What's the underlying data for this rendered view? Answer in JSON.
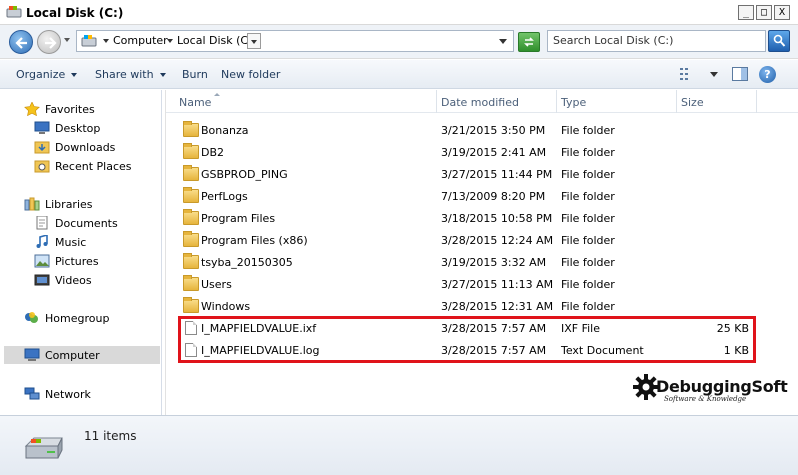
{
  "window": {
    "title": "Local Disk (C:)",
    "controls": [
      "_",
      "□",
      "X"
    ]
  },
  "address": {
    "crumb_computer": "Computer",
    "crumb_current": "Local Disk (C:)",
    "search_placeholder": "Search Local Disk (C:)"
  },
  "toolbar": {
    "organize": "Organize",
    "share_with": "Share with",
    "burn": "Burn",
    "new_folder": "New folder",
    "help": "?"
  },
  "nav": {
    "favorites": "Favorites",
    "desktop": "Desktop",
    "downloads": "Downloads",
    "recent_places": "Recent Places",
    "libraries": "Libraries",
    "documents": "Documents",
    "music": "Music",
    "pictures": "Pictures",
    "videos": "Videos",
    "homegroup": "Homegroup",
    "computer": "Computer",
    "network": "Network"
  },
  "columns": {
    "name": "Name",
    "date_modified": "Date modified",
    "type": "Type",
    "size": "Size"
  },
  "files": [
    {
      "name": "Bonanza",
      "date": "3/21/2015 3:50 PM",
      "type": "File folder",
      "size": "",
      "kind": "folder"
    },
    {
      "name": "DB2",
      "date": "3/19/2015 2:41 AM",
      "type": "File folder",
      "size": "",
      "kind": "folder"
    },
    {
      "name": "GSBPROD_PING",
      "date": "3/27/2015 11:44 PM",
      "type": "File folder",
      "size": "",
      "kind": "folder"
    },
    {
      "name": "PerfLogs",
      "date": "7/13/2009 8:20 PM",
      "type": "File folder",
      "size": "",
      "kind": "folder"
    },
    {
      "name": "Program Files",
      "date": "3/18/2015 10:58 PM",
      "type": "File folder",
      "size": "",
      "kind": "folder"
    },
    {
      "name": "Program Files (x86)",
      "date": "3/28/2015 12:24 AM",
      "type": "File folder",
      "size": "",
      "kind": "folder"
    },
    {
      "name": "tsyba_20150305",
      "date": "3/19/2015 3:32 AM",
      "type": "File folder",
      "size": "",
      "kind": "folder"
    },
    {
      "name": "Users",
      "date": "3/27/2015 11:13 AM",
      "type": "File folder",
      "size": "",
      "kind": "folder"
    },
    {
      "name": "Windows",
      "date": "3/28/2015 12:31 AM",
      "type": "File folder",
      "size": "",
      "kind": "folder"
    },
    {
      "name": "I_MAPFIELDVALUE.ixf",
      "date": "3/28/2015 7:57 AM",
      "type": "IXF File",
      "size": "25 KB",
      "kind": "file"
    },
    {
      "name": "I_MAPFIELDVALUE.log",
      "date": "3/28/2015 7:57 AM",
      "type": "Text Document",
      "size": "1 KB",
      "kind": "file"
    }
  ],
  "status": {
    "items_count": "11 items"
  },
  "watermark": {
    "brand": "DebuggingSoft",
    "tagline": "Software & Knowledge"
  },
  "colors": {
    "highlight": "#e0131a",
    "folder": "#e6b43c"
  }
}
